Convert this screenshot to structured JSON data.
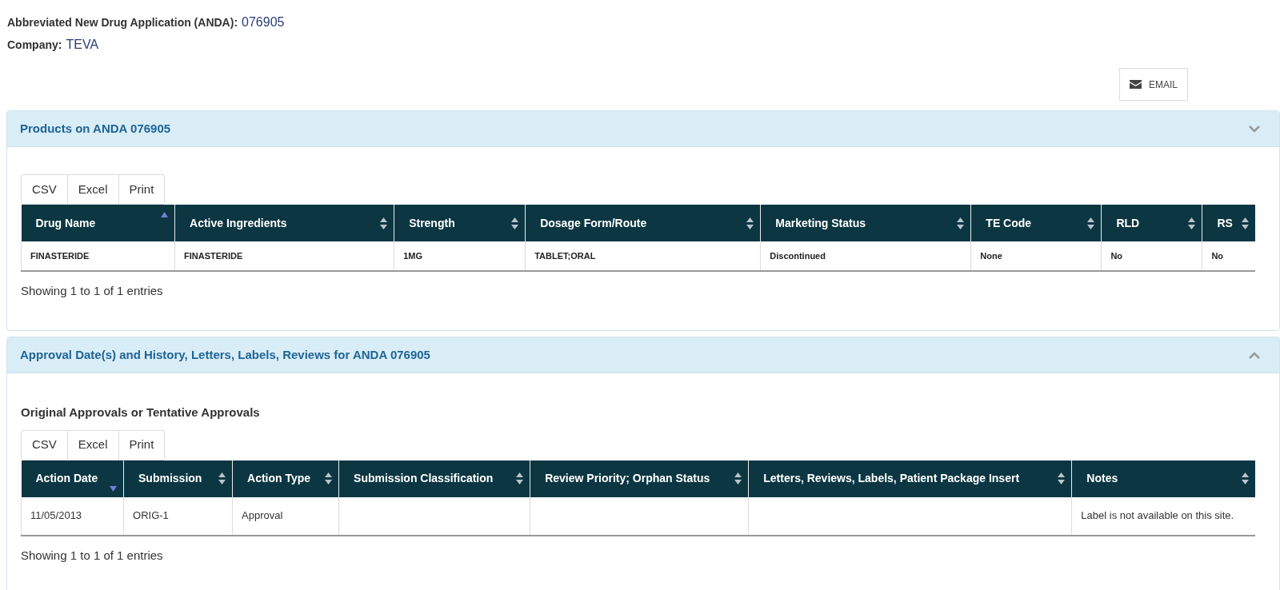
{
  "application": {
    "label": "Abbreviated New Drug Application (ANDA):",
    "value": "076905"
  },
  "company": {
    "label": "Company:",
    "value": "TEVA"
  },
  "email_button": "EMAIL",
  "panels": [
    {
      "title": "Products on ANDA 076905",
      "chevron_up": false,
      "export_buttons": [
        "CSV",
        "Excel",
        "Print"
      ],
      "table": {
        "columns": [
          {
            "label": "Drug Name",
            "sorted": true,
            "descending": false
          },
          {
            "label": "Active Ingredients",
            "sorted": false
          },
          {
            "label": "Strength",
            "sorted": false
          },
          {
            "label": "Dosage Form/Route",
            "sorted": false
          },
          {
            "label": "Marketing Status",
            "sorted": false
          },
          {
            "label": "TE Code",
            "sorted": false
          },
          {
            "label": "RLD",
            "sorted": false
          },
          {
            "label": "RS",
            "sorted": false
          }
        ],
        "rows": [
          [
            "FINASTERIDE",
            "FINASTERIDE",
            "1MG",
            "TABLET;ORAL",
            "Discontinued",
            "None",
            "No",
            "No"
          ]
        ]
      },
      "info": "Showing 1 to 1 of 1 entries"
    },
    {
      "title": "Approval Date(s) and History, Letters, Labels, Reviews for ANDA 076905",
      "chevron_up": true,
      "subtitle": "Original Approvals or Tentative Approvals",
      "export_buttons": [
        "CSV",
        "Excel",
        "Print"
      ],
      "table": {
        "columns": [
          {
            "label": "Action Date",
            "sorted": true,
            "descending": true
          },
          {
            "label": "Submission",
            "sorted": false
          },
          {
            "label": "Action Type",
            "sorted": false
          },
          {
            "label": "Submission Classification",
            "sorted": false
          },
          {
            "label": "Review Priority; Orphan Status",
            "sorted": false
          },
          {
            "label": "Letters, Reviews, Labels, Patient Package Insert",
            "sorted": false
          },
          {
            "label": "Notes",
            "sorted": false
          }
        ],
        "rows": [
          [
            "11/05/2013",
            "ORIG-1",
            "Approval",
            "",
            "",
            "",
            "Label is not available on this site."
          ]
        ]
      },
      "info": "Showing 1 to 1 of 1 entries"
    }
  ]
}
